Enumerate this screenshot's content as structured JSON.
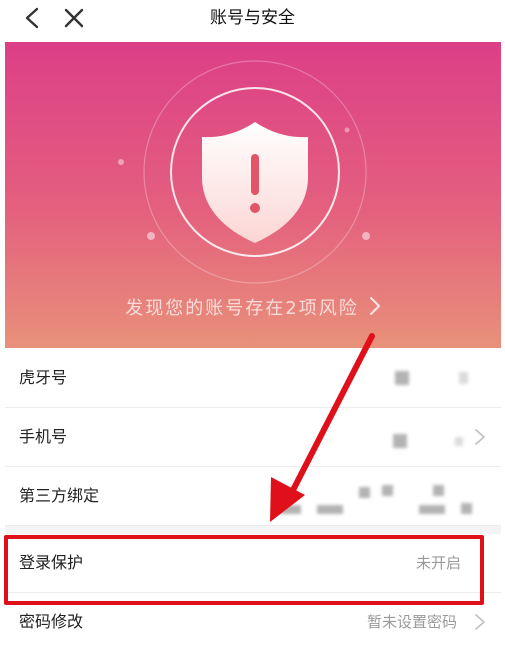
{
  "header": {
    "title": "账号与安全"
  },
  "banner": {
    "risk_text": "发现您的账号存在2项风险"
  },
  "rows": [
    {
      "label": "虎牙号",
      "value": ""
    },
    {
      "label": "手机号",
      "value": ""
    },
    {
      "label": "第三方绑定",
      "value": ""
    },
    {
      "label": "登录保护",
      "value": "未开启"
    },
    {
      "label": "密码修改",
      "value": "暂未设置密码"
    }
  ],
  "colors": {
    "banner_top": "#dc3f87",
    "banner_bottom": "#e8917a",
    "annotation_red": "#e0101a"
  }
}
